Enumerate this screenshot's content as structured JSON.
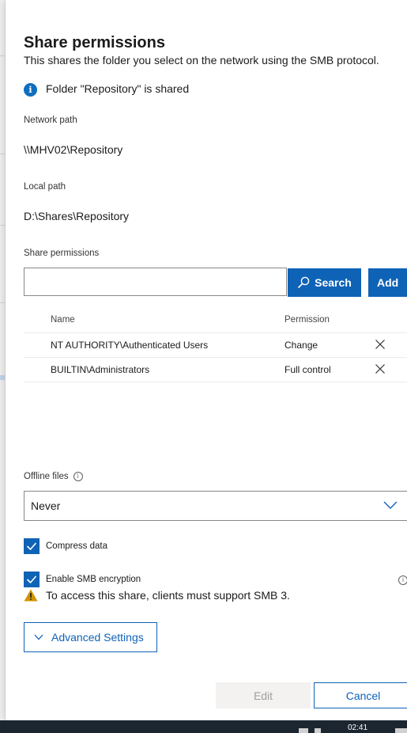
{
  "panel": {
    "title": "Share permissions",
    "subtitle": "This shares the folder you select on the network using the SMB protocol.",
    "info_message": "Folder \"Repository\" is shared"
  },
  "network_path": {
    "label": "Network path",
    "value": "\\\\MHV02\\Repository"
  },
  "local_path": {
    "label": "Local path",
    "value": "D:\\Shares\\Repository"
  },
  "share_permissions": {
    "label": "Share permissions",
    "search_value": "",
    "search_label": "Search",
    "add_label": "Add",
    "columns": {
      "name": "Name",
      "permission": "Permission"
    },
    "rows": [
      {
        "name": "NT AUTHORITY\\Authenticated Users",
        "permission": "Change"
      },
      {
        "name": "BUILTIN\\Administrators",
        "permission": "Full control"
      }
    ]
  },
  "offline_files": {
    "label": "Offline files",
    "value": "Never"
  },
  "options": {
    "compress": {
      "label": "Compress data",
      "checked": true
    },
    "smb_encryption": {
      "label": "Enable SMB encryption",
      "checked": true
    },
    "warning": "To access this share, clients must support SMB 3."
  },
  "advanced": {
    "label": "Advanced Settings"
  },
  "footer": {
    "edit_label": "Edit",
    "cancel_label": "Cancel"
  },
  "taskbar": {
    "clock": "02:41"
  },
  "colors": {
    "accent": "#0f63b6",
    "warning": "#d39300",
    "taskbar": "#1c2631"
  }
}
